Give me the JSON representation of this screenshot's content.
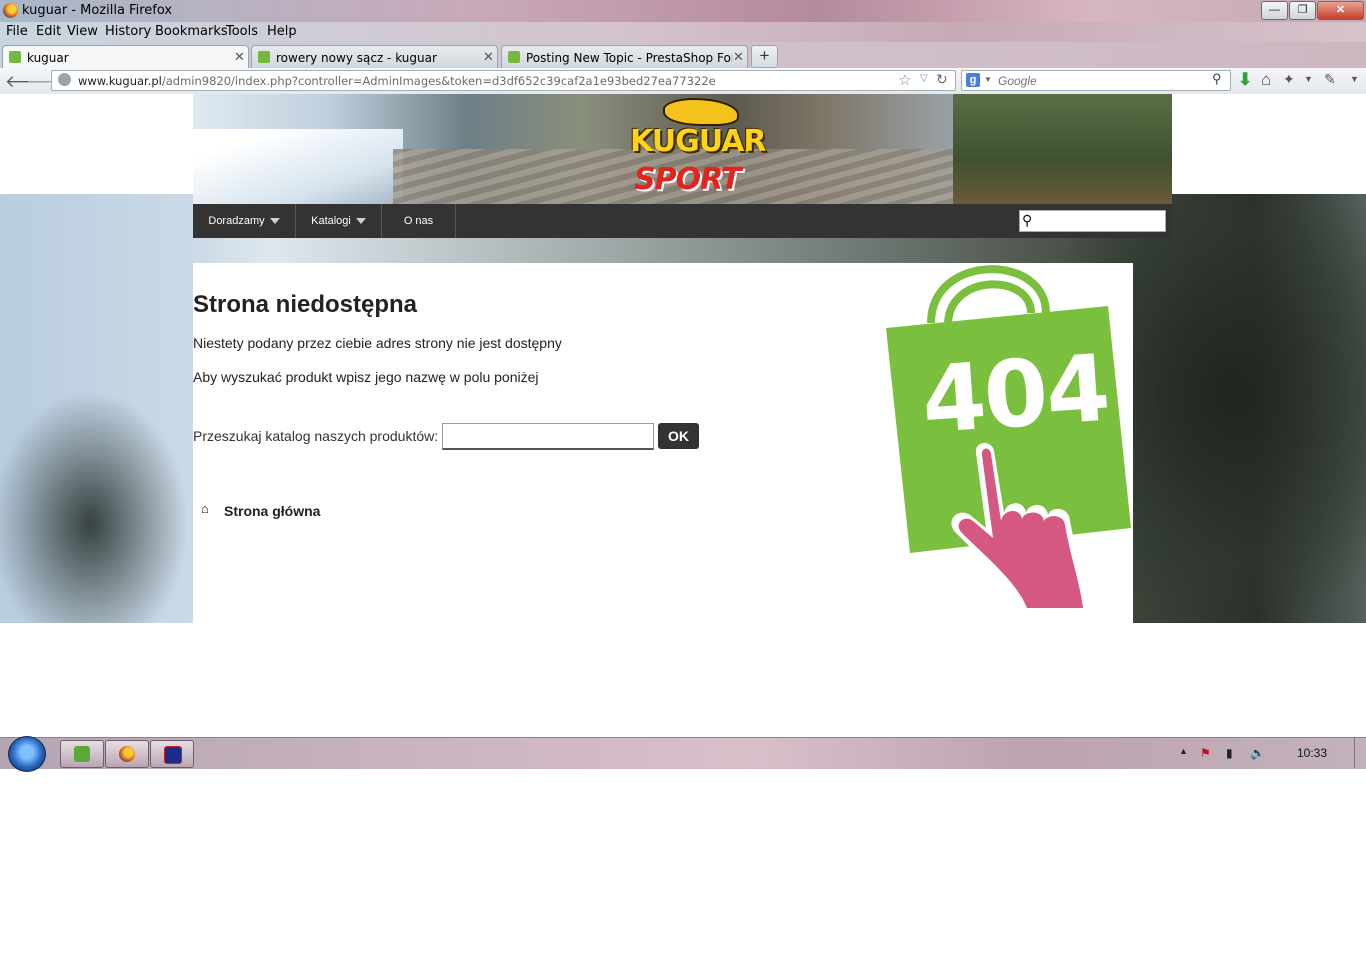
{
  "window": {
    "title": "kuguar - Mozilla Firefox",
    "min": "—",
    "max": "❐",
    "close": "✕"
  },
  "menubar": [
    "File",
    "Edit",
    "View",
    "History",
    "Bookmarks",
    "Tools",
    "Help"
  ],
  "tabs": [
    {
      "label": "kuguar",
      "active": true
    },
    {
      "label": "rowery nowy sącz - kuguar",
      "active": false
    },
    {
      "label": "Posting New Topic - PrestaShop Foru…",
      "active": false
    }
  ],
  "toolbar": {
    "back": "🡐",
    "forward": "🡒",
    "url_domain": "www.kuguar.pl",
    "url_path": "/admin9820/index.php?controller=AdminImages&token=d3df652c39caf2a1e93bed27ea77322e",
    "search_placeholder": "Google",
    "search_engine": "g"
  },
  "site": {
    "logo_top": "KUGUAR",
    "logo_bottom": "SPORT",
    "nav": [
      {
        "label": "Doradzamy",
        "dropdown": true
      },
      {
        "label": "Katalogi",
        "dropdown": true
      },
      {
        "label": "O nas",
        "dropdown": false
      }
    ],
    "search_value": ""
  },
  "error_page": {
    "heading": "Strona niedostępna",
    "line1": "Niestety podany przez ciebie adres strony nie jest dostępny",
    "line2": "Aby wyszukać produkt wpisz jego nazwę w polu poniżej",
    "search_label": "Przeszukaj katalog naszych produktów:",
    "search_value": "",
    "ok_label": "OK",
    "home_link": "Strona główna",
    "badge_text": "404",
    "badge_color": "#7bbf3f",
    "hand_color": "#d4587f"
  },
  "taskbar": {
    "clock": "10:33",
    "apps": [
      "utorrent-icon",
      "firefox-icon",
      "save-icon"
    ]
  }
}
